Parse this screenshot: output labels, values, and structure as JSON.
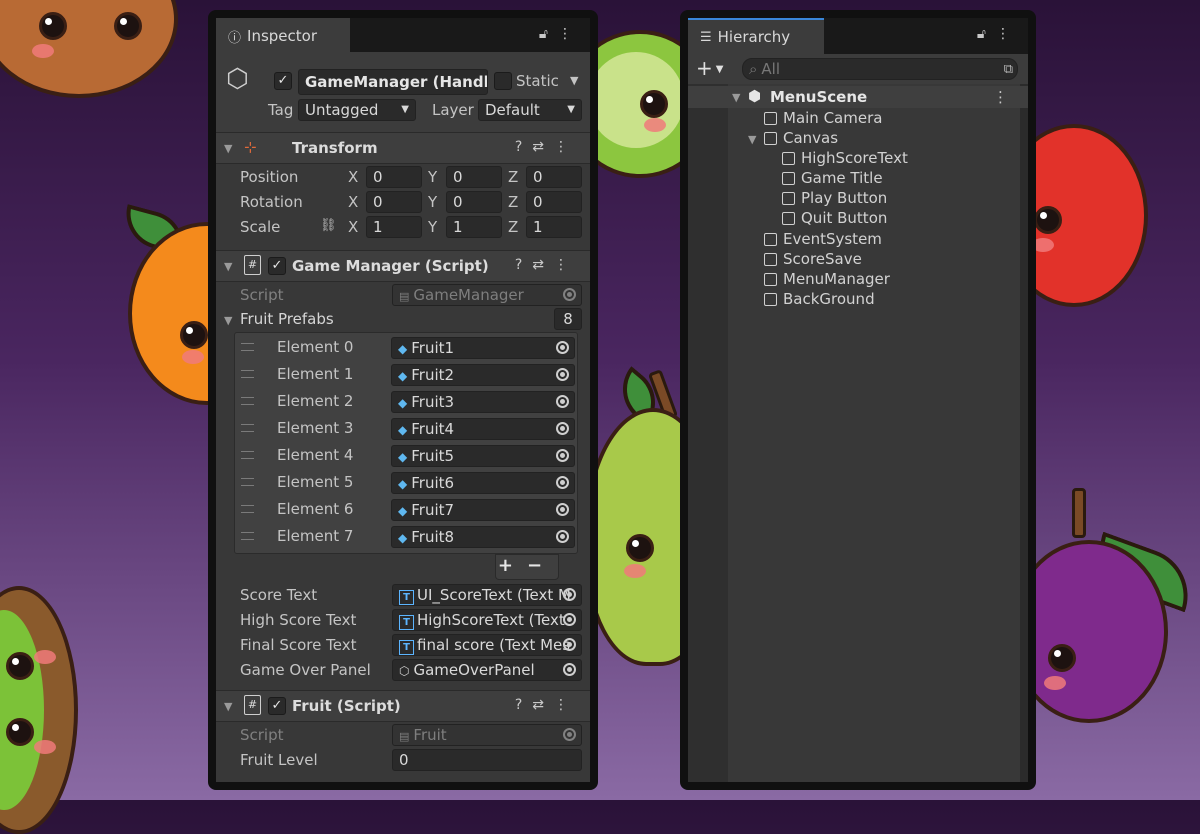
{
  "inspector": {
    "tab_label": "Inspector",
    "tab_icon": "info-icon",
    "object": {
      "name": "GameManager (Handles s",
      "active": true,
      "static_label": "Static",
      "tag_label": "Tag",
      "tag_value": "Untagged",
      "layer_label": "Layer",
      "layer_value": "Default"
    },
    "transform": {
      "title": "Transform",
      "rows": [
        {
          "label": "Position",
          "x": "0",
          "y": "0",
          "z": "0"
        },
        {
          "label": "Rotation",
          "x": "0",
          "y": "0",
          "z": "0"
        },
        {
          "label": "Scale",
          "x": "1",
          "y": "1",
          "z": "1"
        }
      ],
      "axis_x": "X",
      "axis_y": "Y",
      "axis_z": "Z"
    },
    "game_manager": {
      "title": "Game Manager (Script)",
      "enabled": true,
      "script_label": "Script",
      "script_value": "GameManager",
      "fruit_prefabs_label": "Fruit Prefabs",
      "fruit_prefabs_count": "8",
      "elements": [
        {
          "label": "Element 0",
          "value": "Fruit1"
        },
        {
          "label": "Element 1",
          "value": "Fruit2"
        },
        {
          "label": "Element 2",
          "value": "Fruit3"
        },
        {
          "label": "Element 3",
          "value": "Fruit4"
        },
        {
          "label": "Element 4",
          "value": "Fruit5"
        },
        {
          "label": "Element 5",
          "value": "Fruit6"
        },
        {
          "label": "Element 6",
          "value": "Fruit7"
        },
        {
          "label": "Element 7",
          "value": "Fruit8"
        }
      ],
      "plus": "+",
      "minus": "−",
      "fields": [
        {
          "label": "Score Text",
          "value": "UI_ScoreText (Text M",
          "icon": "T"
        },
        {
          "label": "High Score Text",
          "value": "HighScoreText (Text",
          "icon": "T"
        },
        {
          "label": "Final Score Text",
          "value": "final score (Text Mes",
          "icon": "T"
        },
        {
          "label": "Game Over Panel",
          "value": "GameOverPanel",
          "icon": "cube"
        }
      ]
    },
    "fruit": {
      "title": "Fruit (Script)",
      "enabled": true,
      "script_label": "Script",
      "script_value": "Fruit",
      "level_label": "Fruit Level",
      "level_value": "0"
    }
  },
  "hierarchy": {
    "tab_label": "Hierarchy",
    "add_label": "+",
    "search_placeholder": "All",
    "scene": "MenuScene",
    "items": [
      {
        "label": "Main Camera",
        "depth": 1
      },
      {
        "label": "Canvas",
        "depth": 1,
        "expanded": true
      },
      {
        "label": "HighScoreText",
        "depth": 2
      },
      {
        "label": "Game Title",
        "depth": 2
      },
      {
        "label": "Play Button",
        "depth": 2
      },
      {
        "label": "Quit Button",
        "depth": 2
      },
      {
        "label": "EventSystem",
        "depth": 1
      },
      {
        "label": "ScoreSave",
        "depth": 1
      },
      {
        "label": "MenuManager",
        "depth": 1
      },
      {
        "label": "BackGround",
        "depth": 1
      }
    ]
  },
  "colors": {
    "panel": "#383838",
    "panel_border": "#101010",
    "field": "#2a2a2a",
    "header": "#3e3e3e",
    "accent_blue": "#5cb5ff",
    "bg_top": "#2a1238",
    "bg_bottom": "#8a6aa4"
  }
}
